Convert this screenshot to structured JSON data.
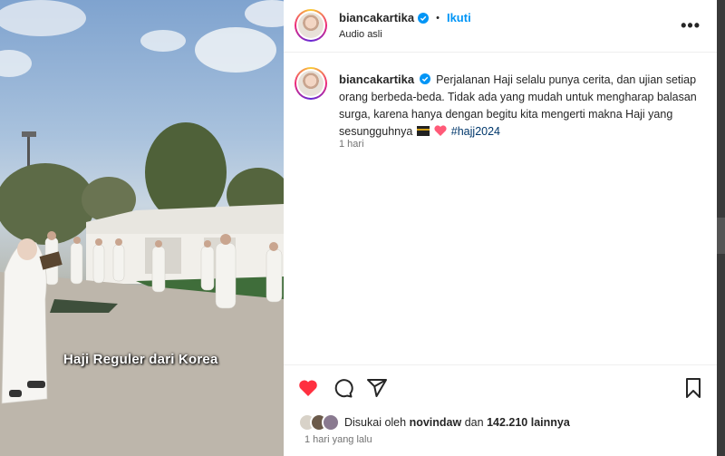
{
  "media": {
    "overlay_caption": "Haji Reguler dari Korea"
  },
  "header": {
    "username": "biancakartika",
    "separator": "•",
    "follow_label": "Ikuti",
    "audio_label": "Audio asli",
    "more_label": "•••"
  },
  "caption": {
    "username": "biancakartika",
    "text": "Perjalanan Haji selalu punya cerita, dan ujian setiap orang berbeda-beda. Tidak ada yang mudah untuk mengharap balasan surga, karena hanya dengan begitu kita mengerti makna Haji yang sesungguhnya",
    "hashtag": "#hajj2024",
    "time": "1 hari"
  },
  "actions": {
    "icons": [
      "heart-filled-icon",
      "comment-icon",
      "share-icon",
      "bookmark-icon"
    ],
    "like_color": "#ff3040"
  },
  "likes": {
    "prefix": "Disukai oleh",
    "user": "novindaw",
    "connector": "dan",
    "count": "142.210 lainnya"
  },
  "post_time": "1 hari yang lalu",
  "colors": {
    "accent": "#0095f6",
    "text": "#262626",
    "muted": "#737373"
  }
}
